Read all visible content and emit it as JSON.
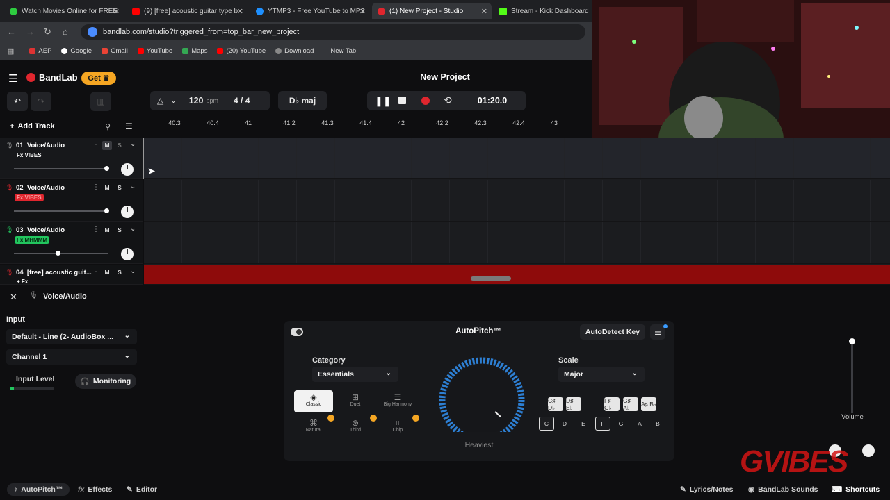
{
  "browser": {
    "tabs": [
      {
        "title": "Watch Movies Online for FREE",
        "color": "#2ecc40"
      },
      {
        "title": "(9) [free] acoustic guitar type b",
        "color": "#ff0000"
      },
      {
        "title": "YTMP3 - Free YouTube to MP3",
        "color": "#1e90ff"
      },
      {
        "title": "(1) New Project - Studio",
        "color": "#e0262e"
      },
      {
        "title": "Stream - Kick Dashboard",
        "color": "#53fc18"
      }
    ],
    "url": "bandlab.com/studio?triggered_from=top_bar_new_project",
    "bookmarks": [
      "AEP",
      "Google",
      "Gmail",
      "YouTube",
      "Maps",
      "(20) YouTube",
      "Download",
      "New Tab"
    ]
  },
  "app": {
    "logo": "BandLab",
    "get_label": "Get",
    "project_title": "New Project",
    "accent": "#e0262e"
  },
  "transport": {
    "bpm": "120",
    "bpm_unit": "bpm",
    "time_sig_num": "4",
    "time_sig_sep": "/",
    "time_sig_den": "4",
    "key": "D♭ maj",
    "time": "01:20.0"
  },
  "ruler": [
    "40.3",
    "40.4",
    "41",
    "41.2",
    "41.3",
    "41.4",
    "42",
    "42.2",
    "42.3",
    "42.4",
    "43"
  ],
  "tracks_header": {
    "add_track": "Add Track"
  },
  "tracks": [
    {
      "num": "01",
      "name": "Voice/Audio",
      "fx": "Fx VIBES",
      "fx_color": "transparent",
      "mute": "M",
      "solo": "S",
      "volume": 0.98
    },
    {
      "num": "02",
      "name": "Voice/Audio",
      "fx": "Fx VIBES",
      "fx_color": "#e0262e",
      "mute": "M",
      "solo": "S",
      "volume": 0.98
    },
    {
      "num": "03",
      "name": "Voice/Audio",
      "fx": "Fx MHMMM",
      "fx_color": "#22c55e",
      "mute": "M",
      "solo": "S",
      "volume": 0.46
    },
    {
      "num": "04",
      "name": "[free] acoustic guit...",
      "fx": "+ Fx",
      "fx_color": "transparent",
      "mute": "M",
      "solo": "S",
      "volume": 0.5
    }
  ],
  "panel": {
    "title": "Voice/Audio",
    "input_label": "Input",
    "input_device": "Default - Line (2- AudioBox ...",
    "channel": "Channel 1",
    "input_level": "Input Level",
    "monitoring": "Monitoring"
  },
  "autopitch": {
    "title": "AutoPitch™",
    "autodetect": "AutoDetect Key",
    "category_label": "Category",
    "category_value": "Essentials",
    "categories": [
      "Classic",
      "Duet",
      "Big Harmony",
      "Natural",
      "Third",
      "Chip"
    ],
    "knob_label": "Heaviest",
    "scale_label": "Scale",
    "scale_value": "Major",
    "sharp_keys": [
      "C♯ D♭",
      "D♯ E♭",
      "F♯ G♭",
      "G♯ A♭",
      "A♯ B♭"
    ],
    "natural_keys": [
      "C",
      "D",
      "E",
      "F",
      "G",
      "A",
      "B"
    ],
    "active_keys": [
      "C",
      "F"
    ],
    "volume_label": "Volume"
  },
  "bottom": {
    "autopitch": "AutoPitch™",
    "effects": "Effects",
    "editor": "Editor",
    "lyrics": "Lyrics/Notes",
    "sounds": "BandLab Sounds",
    "shortcuts": "Shortcuts"
  },
  "overlay": {
    "brand": "GVIBES"
  }
}
